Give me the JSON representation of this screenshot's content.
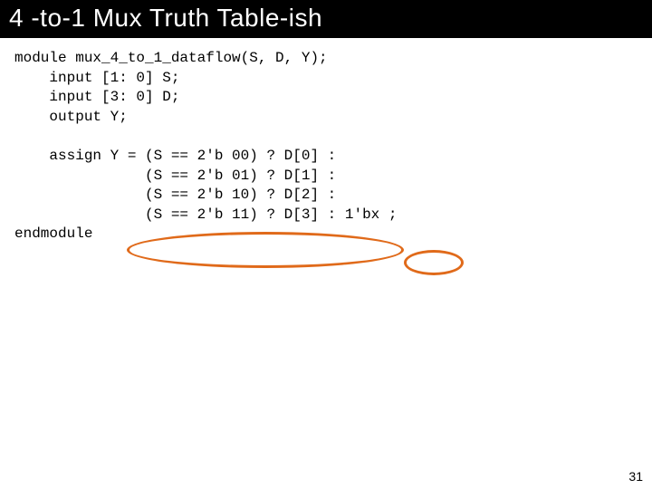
{
  "title": "4 -to-1 Mux Truth Table-ish",
  "code": {
    "l1": "module mux_4_to_1_dataflow(S, D, Y);",
    "l2": "    input [1: 0] S;",
    "l3": "    input [3: 0] D;",
    "l4": "    output Y;",
    "l5": "",
    "l6": "    assign Y = (S == 2'b 00) ? D[0] :",
    "l7": "               (S == 2'b 01) ? D[1] :",
    "l8": "               (S == 2'b 10) ? D[2] :",
    "l9": "               (S == 2'b 11) ? D[3] : 1'bx ;",
    "l10": "endmodule"
  },
  "slide_number": "31"
}
